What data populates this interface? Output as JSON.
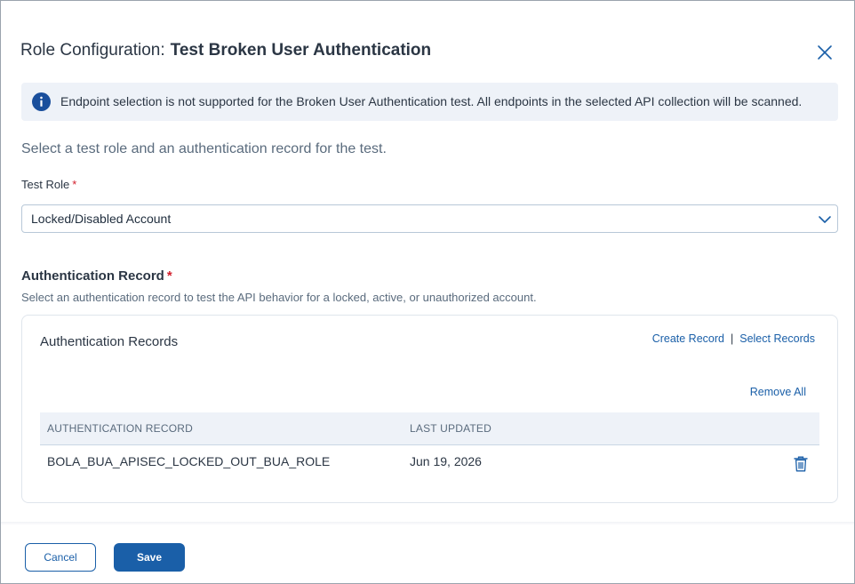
{
  "header": {
    "prefix": "Role Configuration:",
    "name": "Test Broken User Authentication"
  },
  "info_banner": {
    "icon": "info-icon",
    "text": "Endpoint selection is not supported for the Broken User Authentication test. All endpoints in the selected API collection will be scanned."
  },
  "subtitle": "Select a test role and an authentication record for the test.",
  "test_role": {
    "label": "Test Role",
    "required_mark": "*",
    "value": "Locked/Disabled Account"
  },
  "auth_section": {
    "title": "Authentication Record",
    "required_mark": "*",
    "description": "Select an authentication record to test the API behavior for a locked, active, or unauthorized account."
  },
  "records_card": {
    "title": "Authentication Records",
    "create_link": "Create Record",
    "separator": "|",
    "select_link": "Select Records",
    "remove_all": "Remove All",
    "columns": [
      "AUTHENTICATION RECORD",
      "LAST UPDATED"
    ],
    "rows": [
      {
        "record": "BOLA_BUA_APISEC_LOCKED_OUT_BUA_ROLE",
        "updated": "Jun 19, 2026"
      }
    ]
  },
  "footer": {
    "cancel_label": "Cancel",
    "save_label": "Save"
  },
  "colors": {
    "accent": "#1a5fa8",
    "banner_bg": "#eef2f8",
    "required": "#d21e2b"
  }
}
